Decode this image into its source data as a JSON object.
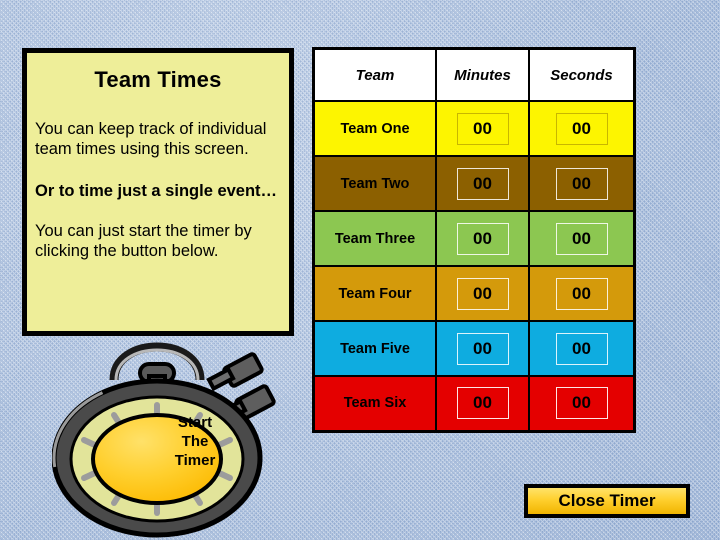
{
  "background": {
    "style": "denim-texture",
    "color": "#b2c6e2"
  },
  "info_panel": {
    "title": "Team Times",
    "paragraph_1": "You can keep track of individual team times using this screen.",
    "paragraph_2": "Or to time just a single event…",
    "paragraph_3": "You can just start the timer by clicking the button below.",
    "background_color": "#eeee99",
    "border_color": "#000000"
  },
  "stopwatch": {
    "button_line_1": "Start",
    "button_line_2": "The",
    "button_line_3": "Timer",
    "body_color": "#4a4a4a",
    "dial_color": "#e2e49a",
    "face_color": "#ffc21a"
  },
  "table": {
    "headers": [
      "Team",
      "Minutes",
      "Seconds"
    ],
    "rows": [
      {
        "team": "Team One",
        "minutes": "00",
        "seconds": "00",
        "color": "#fdf500"
      },
      {
        "team": "Team Two",
        "minutes": "00",
        "seconds": "00",
        "color": "#8c6000"
      },
      {
        "team": "Team Three",
        "minutes": "00",
        "seconds": "00",
        "color": "#8cc751"
      },
      {
        "team": "Team Four",
        "minutes": "00",
        "seconds": "00",
        "color": "#d49a0b"
      },
      {
        "team": "Team Five",
        "minutes": "00",
        "seconds": "00",
        "color": "#0eace0"
      },
      {
        "team": "Team Six",
        "minutes": "00",
        "seconds": "00",
        "color": "#e40000"
      }
    ],
    "header_background": "#ffffff"
  },
  "close_button": {
    "label": "Close Timer",
    "fill_color": "#ffd02e",
    "border_color": "#000000"
  }
}
